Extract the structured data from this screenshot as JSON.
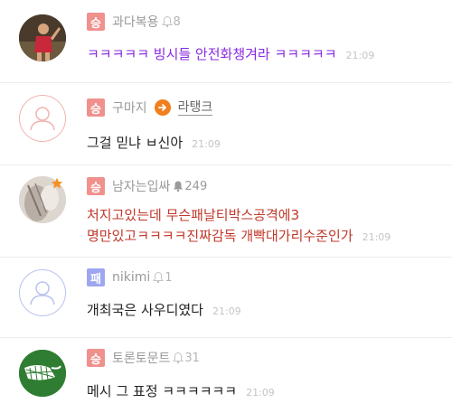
{
  "colors": {
    "win_badge": "#f0918d",
    "lose_badge": "#9fa6f0",
    "purple_text": "#8a2be2",
    "red_text": "#c0392b",
    "default_text": "#222222",
    "orange_arrow": "#f07f1e",
    "star": "#f5901f",
    "placeholder_red": "#f1b4b1",
    "placeholder_blue": "#b9c3ee"
  },
  "comments": [
    {
      "badge": "승",
      "nickname": "과다복용",
      "bell_count": "8",
      "message": "ㅋㅋㅋㅋㅋ 빙시들 안전화챙겨라 ㅋㅋㅋㅋㅋ",
      "time": "21:09",
      "avatar": "photo-player-avatar"
    },
    {
      "badge": "승",
      "nickname": "구마지",
      "arrow_icon": "arrow-right-icon",
      "rank_link": "라탱크",
      "message": "그걸 믿냐 ㅂ신아",
      "time": "21:09",
      "avatar": "default-user-avatar"
    },
    {
      "badge": "승",
      "nickname": "남자는입싸",
      "bell_count": "249",
      "message_lines": [
        "처지고있는데 무슨패날티박스공격에3",
        "명만있고ㅋㅋㅋㅋ진짜감독 개빡대가리수준인가"
      ],
      "time": "21:09",
      "avatar": "photo-blurry-avatar",
      "star_icon": "star-icon"
    },
    {
      "badge": "패",
      "nickname": "nikimi",
      "bell_count": "1",
      "message": "개최국은 사우디였다",
      "time": "21:09",
      "avatar": "default-user-avatar"
    },
    {
      "badge": "승",
      "nickname": "토론토문트",
      "bell_count": "31",
      "message": "메시 그 표정 ㅋㅋㅋㅋㅋㅋ",
      "time": "21:09",
      "avatar": "logo-net-avatar"
    }
  ]
}
